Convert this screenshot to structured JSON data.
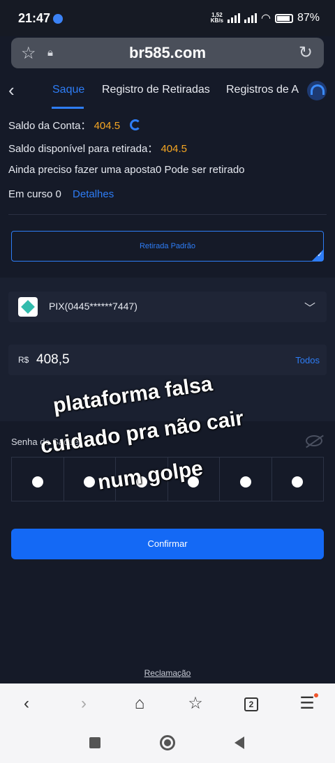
{
  "status_bar": {
    "time": "21:47",
    "net_speed": "1,52",
    "net_unit": "KB/s",
    "battery": "87%"
  },
  "browser": {
    "url": "br585.com"
  },
  "tabs": [
    {
      "label": "Saque",
      "active": true
    },
    {
      "label": "Registro de Retiradas",
      "active": false
    },
    {
      "label": "Registros de A",
      "active": false
    }
  ],
  "account": {
    "balance_label": "Saldo da Conta：",
    "balance_value": "404.5",
    "available_label": "Saldo disponível para retirada：",
    "available_value": "404.5",
    "bet_notice": "Ainda preciso fazer uma aposta0  Pode ser retirado",
    "in_progress_label": "Em curso 0",
    "details_link": "Detalhes"
  },
  "withdraw_method": "Retirada Padrão",
  "pix_account": "PIX(0445******7447)",
  "amount": {
    "currency": "R$",
    "value": "408,5",
    "all_label": "Todos"
  },
  "password": {
    "label": "Senha de Saque",
    "digits_filled": 6
  },
  "overlay_text": [
    "plataforma falsa",
    "cuidado pra não cair",
    "num golpe"
  ],
  "confirm_label": "Confirmar",
  "complaint_link": "Reclamação",
  "browser_nav": {
    "tab_count": "2"
  },
  "colors": {
    "accent": "#2e7df6",
    "highlight": "#f5a623",
    "background": "#151a28",
    "button": "#1469f5"
  }
}
